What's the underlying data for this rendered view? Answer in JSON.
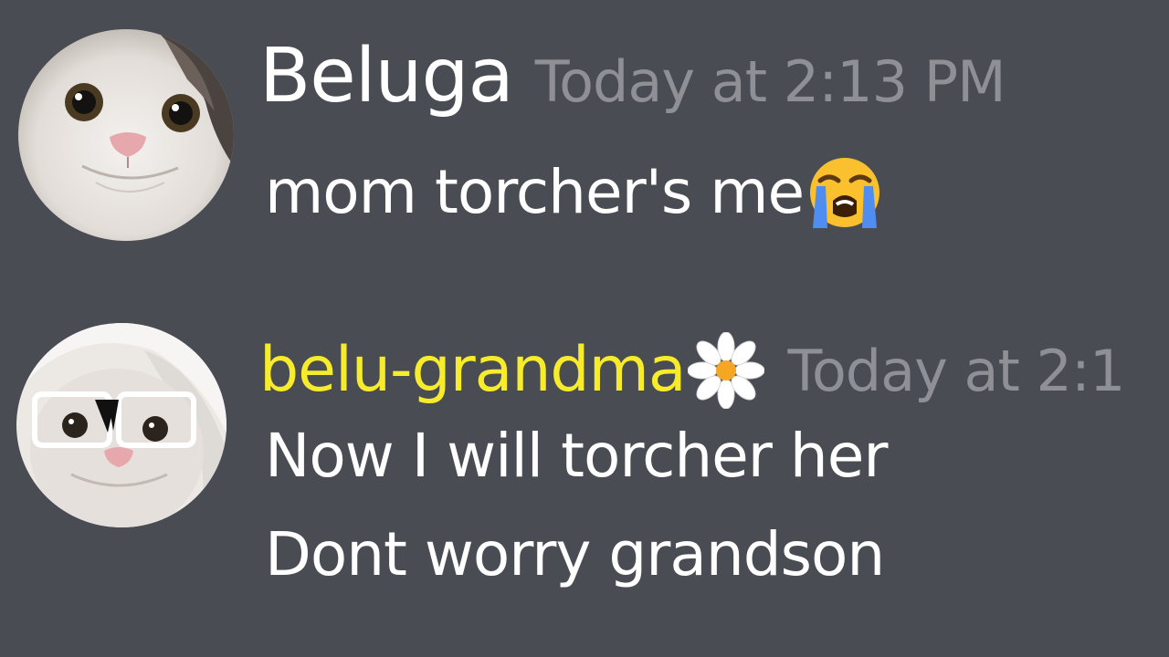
{
  "messages": [
    {
      "author": "Beluga",
      "author_color": "#ffffff",
      "timestamp": "Today at 2:13 PM",
      "avatar_icon": "beluga-cat-avatar",
      "lines": [
        "mom torcher's me"
      ],
      "trailing_emoji": "loudly-crying-face-icon"
    },
    {
      "author": "belu-grandma",
      "author_color": "#f7ec2b",
      "author_badge_icon": "daisy-flower-icon",
      "timestamp": "Today at 2:1",
      "avatar_icon": "grandma-cat-with-glasses-avatar",
      "lines": [
        "Now I will torcher her",
        "Dont worry grandson"
      ]
    }
  ],
  "colors": {
    "background": "#4a4c53",
    "timestamp": "#8e9096",
    "message_text": "#ffffff"
  }
}
